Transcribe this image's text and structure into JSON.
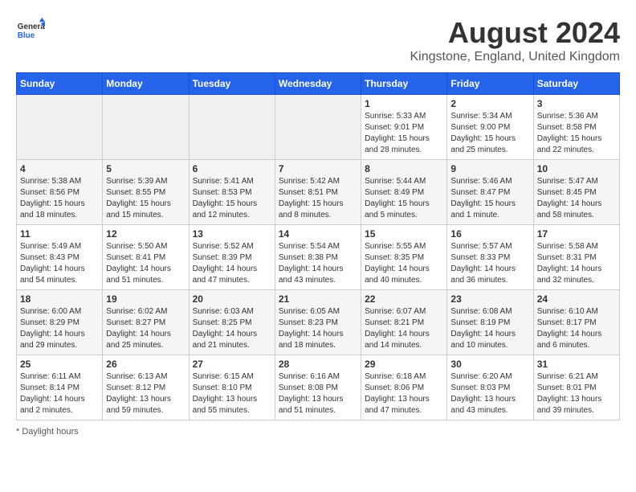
{
  "header": {
    "logo_general": "General",
    "logo_blue": "Blue",
    "main_title": "August 2024",
    "subtitle": "Kingstone, England, United Kingdom"
  },
  "columns": [
    "Sunday",
    "Monday",
    "Tuesday",
    "Wednesday",
    "Thursday",
    "Friday",
    "Saturday"
  ],
  "footer_note": "* Daylight hours",
  "weeks": [
    [
      {
        "day": "",
        "info": ""
      },
      {
        "day": "",
        "info": ""
      },
      {
        "day": "",
        "info": ""
      },
      {
        "day": "",
        "info": ""
      },
      {
        "day": "1",
        "info": "Sunrise: 5:33 AM\nSunset: 9:01 PM\nDaylight: 15 hours\nand 28 minutes."
      },
      {
        "day": "2",
        "info": "Sunrise: 5:34 AM\nSunset: 9:00 PM\nDaylight: 15 hours\nand 25 minutes."
      },
      {
        "day": "3",
        "info": "Sunrise: 5:36 AM\nSunset: 8:58 PM\nDaylight: 15 hours\nand 22 minutes."
      }
    ],
    [
      {
        "day": "4",
        "info": "Sunrise: 5:38 AM\nSunset: 8:56 PM\nDaylight: 15 hours\nand 18 minutes."
      },
      {
        "day": "5",
        "info": "Sunrise: 5:39 AM\nSunset: 8:55 PM\nDaylight: 15 hours\nand 15 minutes."
      },
      {
        "day": "6",
        "info": "Sunrise: 5:41 AM\nSunset: 8:53 PM\nDaylight: 15 hours\nand 12 minutes."
      },
      {
        "day": "7",
        "info": "Sunrise: 5:42 AM\nSunset: 8:51 PM\nDaylight: 15 hours\nand 8 minutes."
      },
      {
        "day": "8",
        "info": "Sunrise: 5:44 AM\nSunset: 8:49 PM\nDaylight: 15 hours\nand 5 minutes."
      },
      {
        "day": "9",
        "info": "Sunrise: 5:46 AM\nSunset: 8:47 PM\nDaylight: 15 hours\nand 1 minute."
      },
      {
        "day": "10",
        "info": "Sunrise: 5:47 AM\nSunset: 8:45 PM\nDaylight: 14 hours\nand 58 minutes."
      }
    ],
    [
      {
        "day": "11",
        "info": "Sunrise: 5:49 AM\nSunset: 8:43 PM\nDaylight: 14 hours\nand 54 minutes."
      },
      {
        "day": "12",
        "info": "Sunrise: 5:50 AM\nSunset: 8:41 PM\nDaylight: 14 hours\nand 51 minutes."
      },
      {
        "day": "13",
        "info": "Sunrise: 5:52 AM\nSunset: 8:39 PM\nDaylight: 14 hours\nand 47 minutes."
      },
      {
        "day": "14",
        "info": "Sunrise: 5:54 AM\nSunset: 8:38 PM\nDaylight: 14 hours\nand 43 minutes."
      },
      {
        "day": "15",
        "info": "Sunrise: 5:55 AM\nSunset: 8:35 PM\nDaylight: 14 hours\nand 40 minutes."
      },
      {
        "day": "16",
        "info": "Sunrise: 5:57 AM\nSunset: 8:33 PM\nDaylight: 14 hours\nand 36 minutes."
      },
      {
        "day": "17",
        "info": "Sunrise: 5:58 AM\nSunset: 8:31 PM\nDaylight: 14 hours\nand 32 minutes."
      }
    ],
    [
      {
        "day": "18",
        "info": "Sunrise: 6:00 AM\nSunset: 8:29 PM\nDaylight: 14 hours\nand 29 minutes."
      },
      {
        "day": "19",
        "info": "Sunrise: 6:02 AM\nSunset: 8:27 PM\nDaylight: 14 hours\nand 25 minutes."
      },
      {
        "day": "20",
        "info": "Sunrise: 6:03 AM\nSunset: 8:25 PM\nDaylight: 14 hours\nand 21 minutes."
      },
      {
        "day": "21",
        "info": "Sunrise: 6:05 AM\nSunset: 8:23 PM\nDaylight: 14 hours\nand 18 minutes."
      },
      {
        "day": "22",
        "info": "Sunrise: 6:07 AM\nSunset: 8:21 PM\nDaylight: 14 hours\nand 14 minutes."
      },
      {
        "day": "23",
        "info": "Sunrise: 6:08 AM\nSunset: 8:19 PM\nDaylight: 14 hours\nand 10 minutes."
      },
      {
        "day": "24",
        "info": "Sunrise: 6:10 AM\nSunset: 8:17 PM\nDaylight: 14 hours\nand 6 minutes."
      }
    ],
    [
      {
        "day": "25",
        "info": "Sunrise: 6:11 AM\nSunset: 8:14 PM\nDaylight: 14 hours\nand 2 minutes."
      },
      {
        "day": "26",
        "info": "Sunrise: 6:13 AM\nSunset: 8:12 PM\nDaylight: 13 hours\nand 59 minutes."
      },
      {
        "day": "27",
        "info": "Sunrise: 6:15 AM\nSunset: 8:10 PM\nDaylight: 13 hours\nand 55 minutes."
      },
      {
        "day": "28",
        "info": "Sunrise: 6:16 AM\nSunset: 8:08 PM\nDaylight: 13 hours\nand 51 minutes."
      },
      {
        "day": "29",
        "info": "Sunrise: 6:18 AM\nSunset: 8:06 PM\nDaylight: 13 hours\nand 47 minutes."
      },
      {
        "day": "30",
        "info": "Sunrise: 6:20 AM\nSunset: 8:03 PM\nDaylight: 13 hours\nand 43 minutes."
      },
      {
        "day": "31",
        "info": "Sunrise: 6:21 AM\nSunset: 8:01 PM\nDaylight: 13 hours\nand 39 minutes."
      }
    ]
  ]
}
